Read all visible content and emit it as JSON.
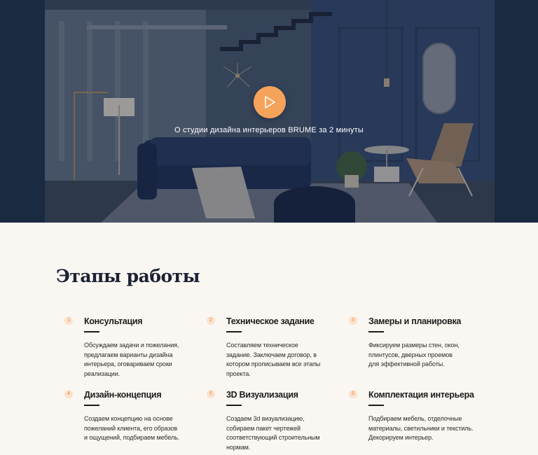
{
  "hero": {
    "caption": "О студии дизайна интерьеров BRUME за 2 минуты"
  },
  "icons": {
    "play": "play-icon"
  },
  "colors": {
    "accent": "#f5a35a",
    "background": "#faf7f2",
    "navy": "#1a2a40"
  },
  "stages_section": {
    "title": "Этапы работы",
    "stages": [
      {
        "number": "1",
        "title": "Консультация",
        "text": "Обсуждаем задачи и пожелания, предлагаем варианты дизайна интерьера, оговариваем сроки реализации."
      },
      {
        "number": "2",
        "title": "Техническое задание",
        "text": "Составляем техническое задание. Заключаем договор, в котором прописываем все этапы проекта."
      },
      {
        "number": "3",
        "title": "Замеры и планировка",
        "text": "Фиксируем размеры стен, окон, плинтусов, дверных проемов для эффективной работы."
      },
      {
        "number": "4",
        "title": "Дизайн-концепция",
        "text": "Создаем концепцию на основе пожеланий клиента, его образов и ощущений, подбираем мебель."
      },
      {
        "number": "5",
        "title": "3D Визуализация",
        "text": "Создаем 3d визуализацию, собираем пакет чертежей соответствующий строительным нормам."
      },
      {
        "number": "6",
        "title": "Комплектация интерьера",
        "text": "Подбираем мебель, отделочные материалы, светильники и текстиль. Декорируем интерьер."
      }
    ]
  }
}
